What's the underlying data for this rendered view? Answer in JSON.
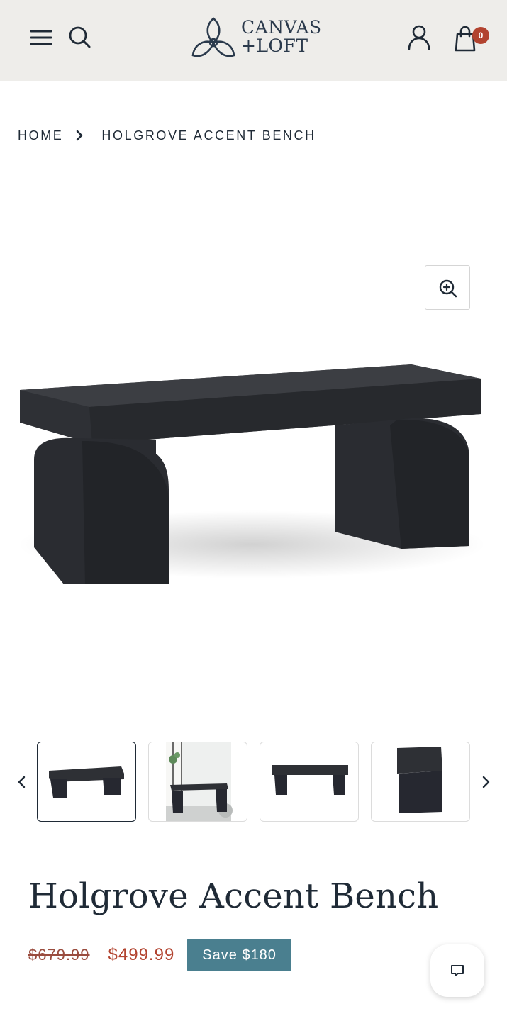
{
  "header": {
    "brand_line1": "CANVAS",
    "brand_line2": "+LOFT",
    "cart_count": "0"
  },
  "breadcrumb": {
    "home": "HOME",
    "current": "HOLGROVE ACCENT BENCH"
  },
  "gallery": {
    "thumbnail_count": 4,
    "active_index": 0
  },
  "product": {
    "title": "Holgrove Accent Bench",
    "compare_price": "$679.99",
    "sale_price": "$499.99",
    "save_label": "Save $180"
  },
  "colors": {
    "header_bg": "#eeedea",
    "sale": "#b2432f",
    "badge": "#4a7f8f",
    "ink": "#1f2a36"
  },
  "icons": [
    "menu-icon",
    "search-icon",
    "account-icon",
    "cart-icon",
    "zoom-in-icon",
    "chevron-right-icon",
    "chevron-left-icon",
    "chat-icon"
  ]
}
